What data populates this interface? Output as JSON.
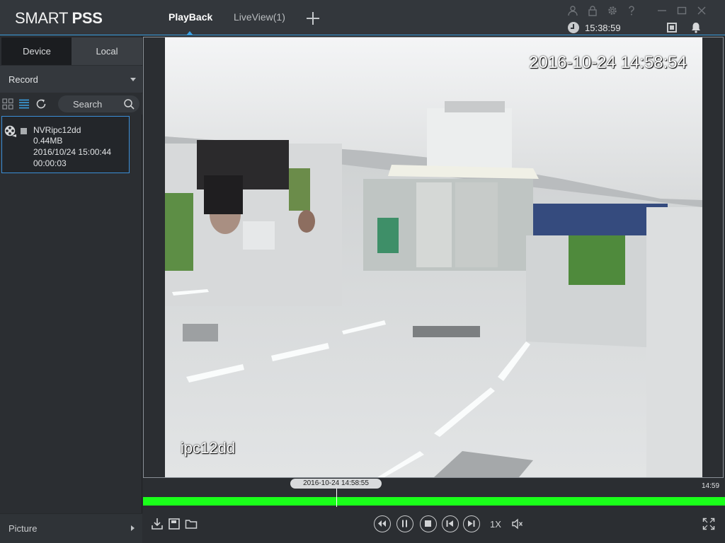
{
  "app": {
    "title_light": "SMART ",
    "title_bold": "PSS"
  },
  "tabs": [
    {
      "label": "PlayBack",
      "active": true
    },
    {
      "label": "LiveView(1)",
      "active": false
    }
  ],
  "header": {
    "clock": "15:38:59"
  },
  "sidebar": {
    "tabs": [
      "Device",
      "Local"
    ],
    "record_dropdown": "Record",
    "search_label": "Search",
    "file": {
      "name": "NVRipc12dd",
      "size": "0.44MB",
      "datetime": "2016/10/24 15:00:44",
      "duration": "00:00:03"
    },
    "bottom_label": "Picture"
  },
  "video": {
    "osd_timestamp": "2016-10-24 14:58:54",
    "osd_camera": "ipc12dd"
  },
  "timeline": {
    "cursor_time": "2016-10-24 14:58:55",
    "end_label": "14:59"
  },
  "controls": {
    "speed": "1X"
  },
  "colors": {
    "accent": "#3b9fe0",
    "track": "#1aff1a",
    "selection_border": "#3b8fd8"
  }
}
